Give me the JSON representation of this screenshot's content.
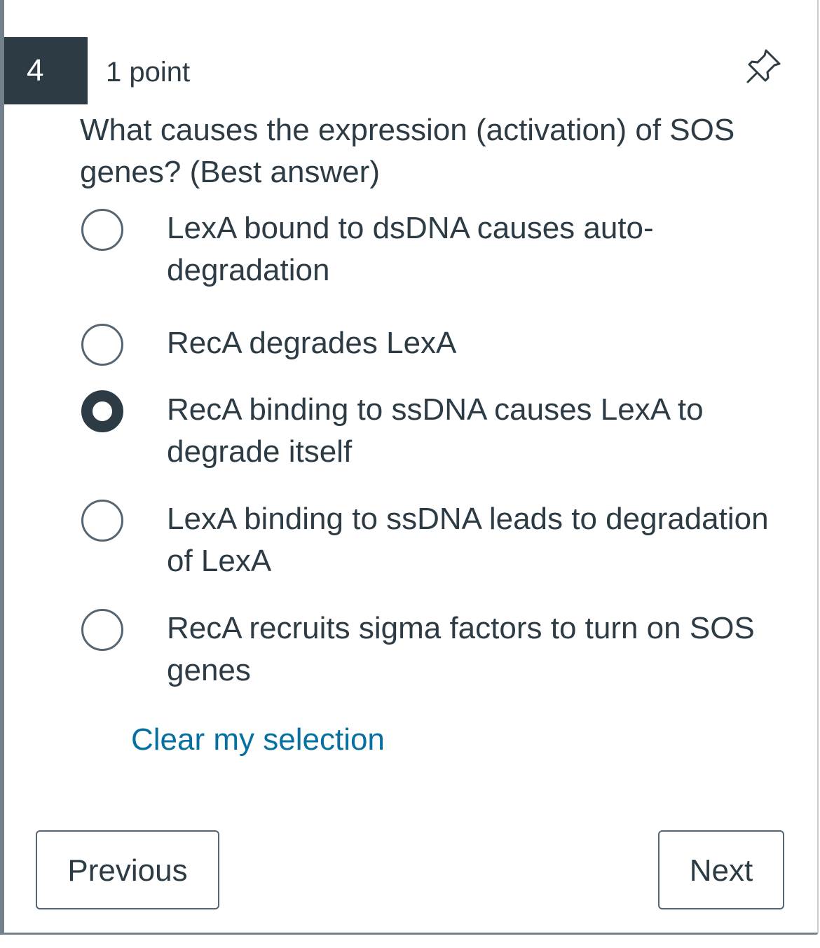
{
  "question": {
    "number": "4",
    "points": "1 point",
    "text": "What causes the expression (activation) of SOS genes? (Best answer)",
    "pin_icon": "pin-icon"
  },
  "options": [
    {
      "label": "LexA bound to dsDNA causes auto-degradation",
      "selected": false
    },
    {
      "label": "RecA degrades LexA",
      "selected": false
    },
    {
      "label": "RecA binding to ssDNA causes LexA to degrade itself",
      "selected": true
    },
    {
      "label": "LexA binding to ssDNA leads to degradation of LexA",
      "selected": false
    },
    {
      "label": "RecA recruits sigma factors to turn on SOS genes",
      "selected": false
    }
  ],
  "clear_link": "Clear my selection",
  "nav": {
    "previous_label": "Previous",
    "next_label": "Next"
  },
  "colors": {
    "text": "#2d3b45",
    "number_bg": "#2d3b45",
    "link": "#0770a3",
    "border": "#556572"
  }
}
